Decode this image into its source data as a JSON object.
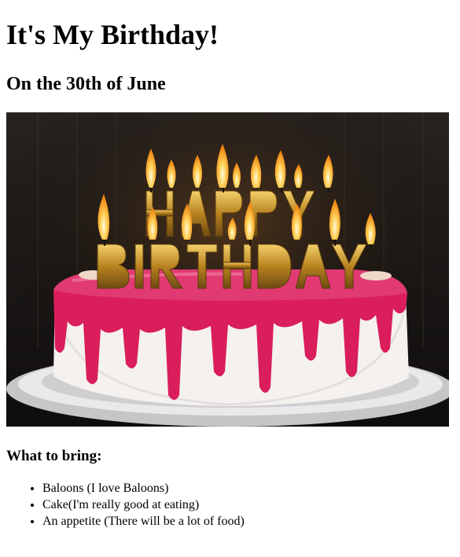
{
  "page": {
    "title": "It's My Birthday!",
    "subtitle": "On the 30th of June",
    "image": {
      "alt": "Birthday cake with Happy Birthday candles"
    },
    "bring_heading": "What to bring:",
    "bring_items": [
      "Baloons (I love Baloons)",
      "Cake(I'm really good at eating)",
      "An appetite (There will be a lot of food)"
    ]
  },
  "colors": {
    "frosting": "#d91e5b",
    "cake": "#f4f1ef",
    "candle_gold": "#c9972a",
    "flame": "#ffb52e",
    "background_dark": "#1a1716"
  }
}
